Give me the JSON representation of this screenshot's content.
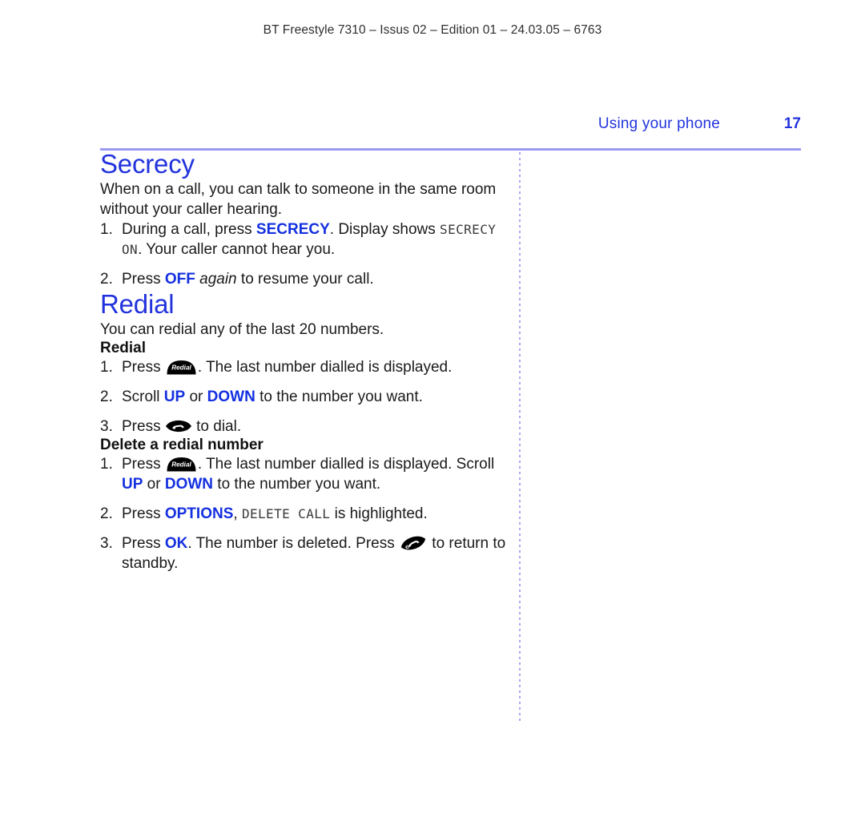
{
  "running_header": "BT Freestyle 7310 – Issus 02 – Edition 01 – 24.03.05 – 6763",
  "page_head": {
    "section_title": "Using your phone",
    "folio": "17"
  },
  "colors": {
    "heading_blue": "#2233dd",
    "keyword_blue": "#1430e0",
    "rule_lavender": "#9a9af5",
    "divider_lavender": "#a8a8f2",
    "body_text": "#1a1a1a",
    "lcd_text": "#3a3a3a"
  },
  "sections": {
    "secrecy": {
      "heading": "Secrecy",
      "intro": "When on a call, you can talk to someone in the same room without your caller hearing.",
      "steps": [
        {
          "num": "1.",
          "before": "During a call, press ",
          "key": "SECRECY",
          "mid": ". Display shows ",
          "lcd": "SECRECY ON",
          "after": ". Your caller cannot hear you."
        },
        {
          "num": "2.",
          "before": "Press ",
          "key": "OFF",
          "italic": " again",
          "after": " to resume your call."
        }
      ]
    },
    "redial": {
      "heading": "Redial",
      "intro": "You can redial any of the last 20 numbers.",
      "sub_redial": {
        "heading": "Redial",
        "steps": [
          {
            "num": "1.",
            "before": "Press ",
            "icon": "redial-key-icon",
            "icon_label": "Redial",
            "after": ". The last number dialled is displayed."
          },
          {
            "num": "2.",
            "before": "Scroll ",
            "key1": "UP",
            "mid": " or ",
            "key2": "DOWN",
            "after": " to the number you want."
          },
          {
            "num": "3.",
            "before": "Press ",
            "icon": "talk-key-icon",
            "after": " to dial."
          }
        ]
      },
      "sub_delete": {
        "heading": "Delete a redial number",
        "steps": [
          {
            "num": "1.",
            "before": "Press ",
            "icon": "redial-key-icon",
            "icon_label": "Redial",
            "mid": ". The last number dialled is displayed. Scroll ",
            "key1": "UP",
            "mid2": " or ",
            "key2": "DOWN",
            "after": " to the number you want."
          },
          {
            "num": "2.",
            "before": "Press ",
            "key": "OPTIONS",
            "mid": ", ",
            "lcd": "DELETE CALL",
            "after": " is highlighted."
          },
          {
            "num": "3.",
            "before": "Press ",
            "key": "OK",
            "mid": ". The number is deleted. Press ",
            "icon": "end-call-key-icon",
            "after": " to return to standby."
          }
        ]
      }
    }
  }
}
